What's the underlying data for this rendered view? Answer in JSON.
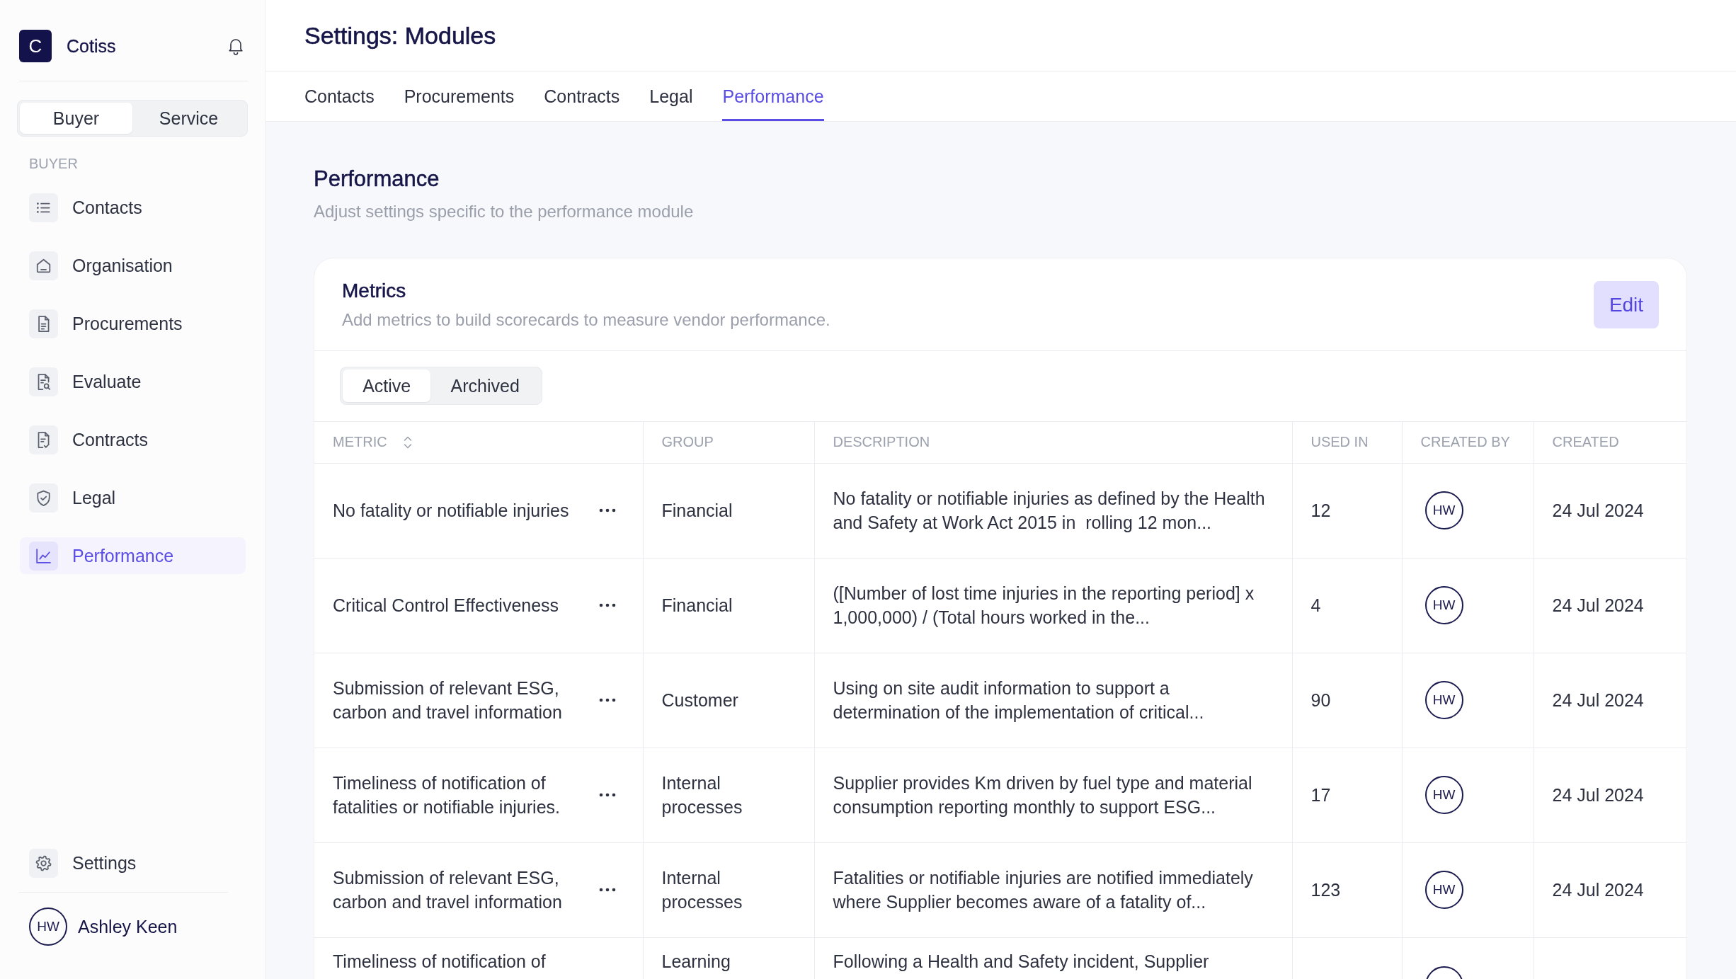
{
  "sidebar": {
    "logo": {
      "letter": "C",
      "name": "Cotiss"
    },
    "role_switch": [
      {
        "label": "Buyer",
        "selected": true
      },
      {
        "label": "Service",
        "selected": false
      }
    ],
    "section_label": "BUYER",
    "items": [
      {
        "label": "Contacts",
        "selected": false
      },
      {
        "label": "Organisation",
        "selected": false
      },
      {
        "label": "Procurements",
        "selected": false
      },
      {
        "label": "Evaluate",
        "selected": false
      },
      {
        "label": "Contracts",
        "selected": false
      },
      {
        "label": "Legal",
        "selected": false
      },
      {
        "label": "Performance",
        "selected": true
      }
    ],
    "footer_items": [
      {
        "label": "Settings",
        "selected": false
      }
    ],
    "user": {
      "initials": "HW",
      "name": "Ashley Keen"
    }
  },
  "header": {
    "title": "Settings: Modules"
  },
  "tabs": [
    {
      "label": "Contacts",
      "selected": false
    },
    {
      "label": "Procurements",
      "selected": false
    },
    {
      "label": "Contracts",
      "selected": false
    },
    {
      "label": "Legal",
      "selected": false
    },
    {
      "label": "Performance",
      "selected": true
    }
  ],
  "section": {
    "title": "Performance",
    "subtitle": "Adjust settings specific to the performance module"
  },
  "metrics_card": {
    "title": "Metrics",
    "subtitle": "Add metrics to build scorecards to measure vendor performance.",
    "edit_button": {
      "label": "Edit"
    },
    "filter": [
      {
        "label": "Active",
        "selected": true
      },
      {
        "label": "Archived",
        "selected": false
      }
    ],
    "table": {
      "columns": [
        {
          "label": "METRIC",
          "sortable": true
        },
        {
          "label": "GROUP",
          "sortable": false
        },
        {
          "label": "DESCRIPTION",
          "sortable": false
        },
        {
          "label": "USED IN",
          "sortable": false
        },
        {
          "label": "CREATED BY",
          "sortable": false
        },
        {
          "label": "CREATED",
          "sortable": false
        }
      ],
      "rows": [
        {
          "metric": "No fatality or notifiable injuries",
          "group": "Financial",
          "description": "No fatality or notifiable injuries as defined by the Health and Safety at Work Act 2015 in  rolling 12 mon...",
          "used_in": "12",
          "created_by": "HW",
          "created": "24 Jul 2024"
        },
        {
          "metric": "Critical Control Effectiveness",
          "group": "Financial",
          "description": "([Number of lost time injuries in the reporting period] x 1,000,000) / (Total hours worked in the...",
          "used_in": "4",
          "created_by": "HW",
          "created": "24 Jul 2024"
        },
        {
          "metric": "Submission of relevant ESG, carbon and travel information",
          "group": "Customer",
          "description": "Using on site audit information to support a determination of the implementation of critical...",
          "used_in": "90",
          "created_by": "HW",
          "created": "24 Jul 2024"
        },
        {
          "metric": "Timeliness of notification of fatalities or notifiable injuries.",
          "group": "Internal processes",
          "description": "Supplier provides Km driven by fuel type and material consumption reporting monthly to support ESG...",
          "used_in": "17",
          "created_by": "HW",
          "created": "24 Jul 2024"
        },
        {
          "metric": "Submission of relevant ESG, carbon and travel information",
          "group": "Internal processes",
          "description": "Fatalities or notifiable injuries are notified immediately where Supplier becomes aware of a fatality of...",
          "used_in": "123",
          "created_by": "HW",
          "created": "24 Jul 2024"
        },
        {
          "metric": "Timeliness of notification of",
          "group": "Learning",
          "description": "Following a Health and Safety incident, Supplier"
        }
      ]
    }
  }
}
